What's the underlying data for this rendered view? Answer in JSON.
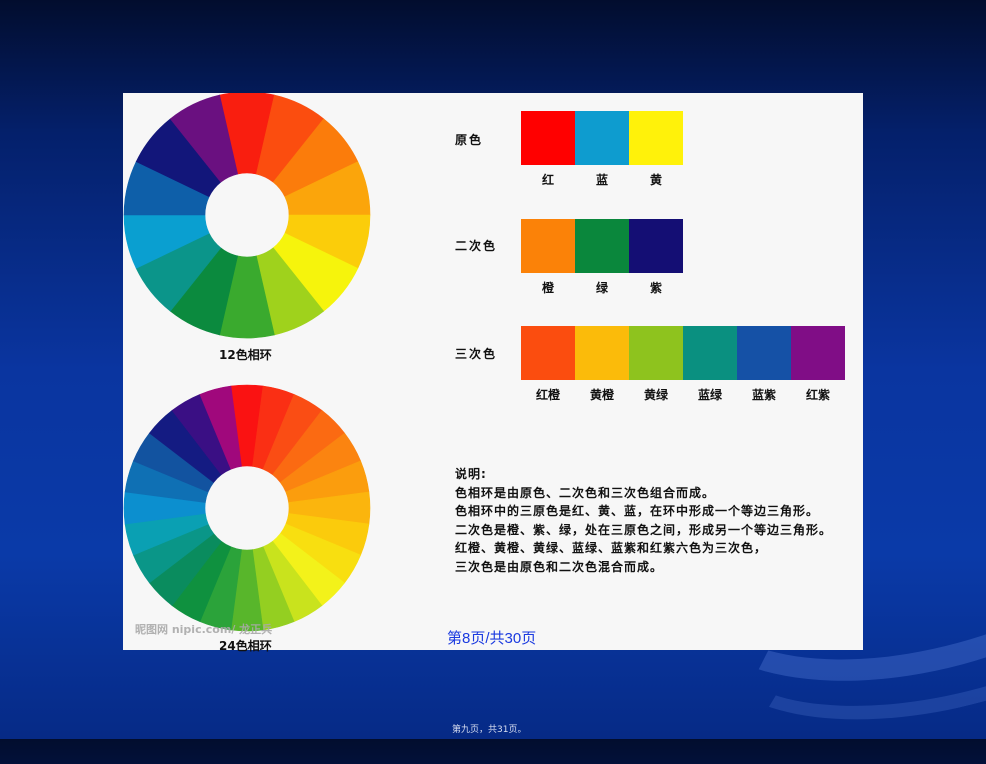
{
  "wheel12": {
    "caption": "12色相环",
    "colors": [
      "#f91e0f",
      "#fb4d0f",
      "#fb7c0b",
      "#fba50b",
      "#fbcd0a",
      "#f6f40c",
      "#9fd21c",
      "#3aaa2e",
      "#0b8a3e",
      "#0b958a",
      "#0a9fd0",
      "#0e5fa9",
      "#12167a",
      "#6a1080"
    ]
  },
  "wheel24": {
    "caption": "24色相环",
    "colors": [
      "#fa1212",
      "#fa2f14",
      "#fa4d14",
      "#fb6a12",
      "#fb8410",
      "#fb9d0d",
      "#fbb50d",
      "#fbcb0c",
      "#f8df10",
      "#f3f21a",
      "#c9e31d",
      "#94cf21",
      "#58b62b",
      "#2ba33a",
      "#0f913f",
      "#0a8c5e",
      "#0a9688",
      "#0aa0b3",
      "#0c8fcf",
      "#0f70b4",
      "#1253a0",
      "#141b82",
      "#3a0f84",
      "#a0087c"
    ]
  },
  "primary": {
    "label": "原色",
    "swatches": [
      {
        "name": "红",
        "color": "#ff0000"
      },
      {
        "name": "蓝",
        "color": "#0e9ccf"
      },
      {
        "name": "黄",
        "color": "#fff20a"
      }
    ]
  },
  "secondary": {
    "label": "二次色",
    "swatches": [
      {
        "name": "橙",
        "color": "#fb8208"
      },
      {
        "name": "绿",
        "color": "#0a873c"
      },
      {
        "name": "紫",
        "color": "#140e74"
      }
    ]
  },
  "tertiary": {
    "label": "三次色",
    "swatches": [
      {
        "name": "红橙",
        "color": "#fb4d0f"
      },
      {
        "name": "黄橙",
        "color": "#fbbb0a"
      },
      {
        "name": "黄绿",
        "color": "#8ec31e"
      },
      {
        "name": "蓝绿",
        "color": "#0a9080"
      },
      {
        "name": "蓝紫",
        "color": "#1551a6"
      },
      {
        "name": "红紫",
        "color": "#800d86"
      }
    ]
  },
  "notes": {
    "title": "说明:",
    "lines": [
      "色相环是由原色、二次色和三次色组合而成。",
      "色相环中的三原色是红、黄、蓝，在环中形成一个等边三角形。",
      "二次色是橙、紫、绿，处在三原色之间，形成另一个等边三角形。",
      "红橙、黄橙、黄绿、蓝绿、蓝紫和红紫六色为三次色，",
      "三次色是由原色和二次色混合而成。"
    ]
  },
  "watermark": "昵图网 nipic.com/ 龙正兵",
  "page_indicator": "第8页/共30页",
  "footer": "第九页，共31页。"
}
